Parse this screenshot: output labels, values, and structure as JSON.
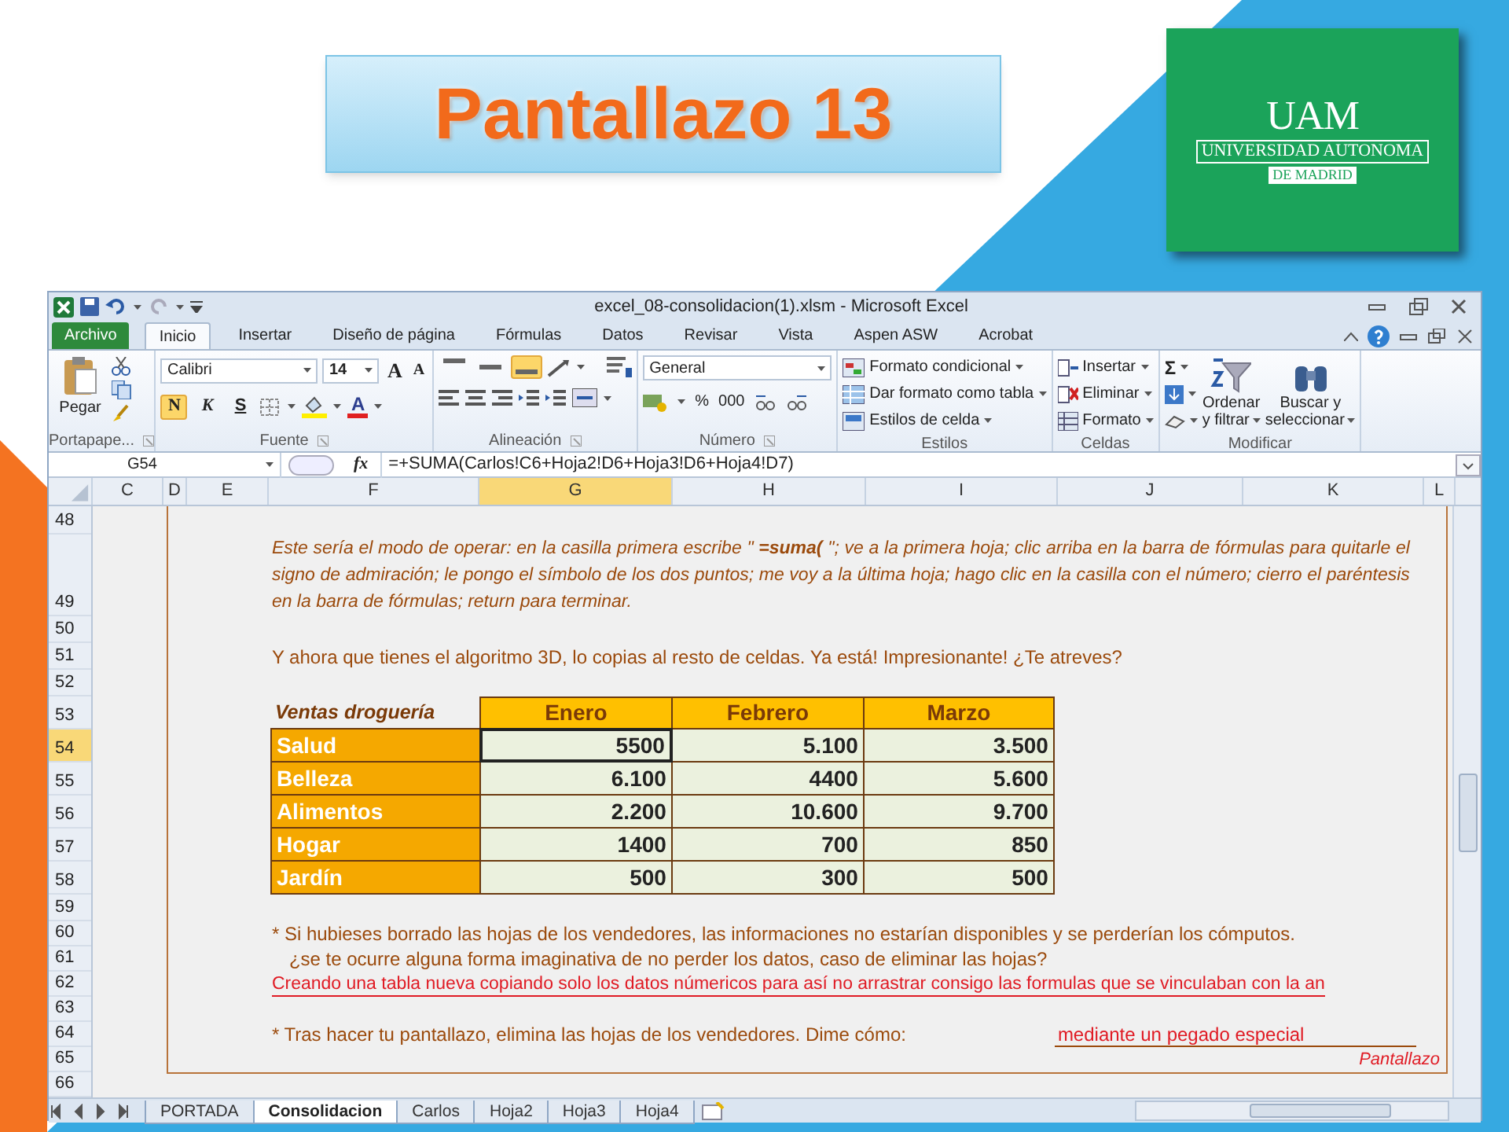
{
  "slide": {
    "title": "Pantallazo 13",
    "logo": {
      "initials": "UAM",
      "name": "UNIVERSIDAD AUTONOMA",
      "subtitle": "DE MADRID"
    }
  },
  "excel": {
    "window_title": "excel_08-consolidacion(1).xlsm - Microsoft Excel",
    "ribbon_tabs": [
      {
        "label": "Archivo",
        "kind": "file",
        "selected": false
      },
      {
        "label": "Inicio",
        "kind": "tab",
        "selected": true
      },
      {
        "label": "Insertar",
        "kind": "tab",
        "selected": false
      },
      {
        "label": "Diseño de página",
        "kind": "tab",
        "selected": false
      },
      {
        "label": "Fórmulas",
        "kind": "tab",
        "selected": false
      },
      {
        "label": "Datos",
        "kind": "tab",
        "selected": false
      },
      {
        "label": "Revisar",
        "kind": "tab",
        "selected": false
      },
      {
        "label": "Vista",
        "kind": "tab",
        "selected": false
      },
      {
        "label": "Aspen ASW",
        "kind": "tab",
        "selected": false
      },
      {
        "label": "Acrobat",
        "kind": "tab",
        "selected": false
      }
    ],
    "ribbon": {
      "clipboard": {
        "label": "Portapape...",
        "paste": "Pegar"
      },
      "font": {
        "label": "Fuente",
        "font_name": "Calibri",
        "font_size": "14",
        "grow": "A",
        "shrink": "A",
        "font_color": "A",
        "styles": [
          {
            "label": "N",
            "on": true
          },
          {
            "label": "K",
            "on": false
          },
          {
            "label": "S",
            "on": false
          }
        ]
      },
      "alignment": {
        "label": "Alineación",
        "vertical": [
          {
            "selected": false
          },
          {
            "selected": false
          },
          {
            "selected": true
          }
        ]
      },
      "number": {
        "label": "Número",
        "format": "General",
        "percent": "%",
        "thousands": "000"
      },
      "styles": {
        "label": "Estilos",
        "items": [
          "Formato condicional",
          "Dar formato como tabla",
          "Estilos de celda"
        ]
      },
      "cells": {
        "label": "Celdas",
        "items": [
          "Insertar",
          "Eliminar",
          "Formato"
        ]
      },
      "editing": {
        "label": "Modificar",
        "sum": "Σ",
        "sort": [
          "Ordenar",
          "y filtrar"
        ],
        "find": [
          "Buscar y",
          "seleccionar"
        ]
      }
    },
    "name_box": "G54",
    "function_label": "fx",
    "formula": "=+SUMA(Carlos!C6+Hoja2!D6+Hoja3!D6+Hoja4!D7)",
    "columns": [
      {
        "label": "C",
        "selected": false
      },
      {
        "label": "D",
        "selected": false
      },
      {
        "label": "E",
        "selected": false
      },
      {
        "label": "F",
        "selected": false
      },
      {
        "label": "G",
        "selected": true
      },
      {
        "label": "H",
        "selected": false
      },
      {
        "label": "I",
        "selected": false
      },
      {
        "label": "J",
        "selected": false
      },
      {
        "label": "K",
        "selected": false
      },
      {
        "label": "L",
        "selected": false
      }
    ],
    "rows": [
      {
        "number": "48",
        "selected": false
      },
      {
        "number": "49",
        "selected": false
      },
      {
        "number": "50",
        "selected": false
      },
      {
        "number": "51",
        "selected": false
      },
      {
        "number": "52",
        "selected": false
      },
      {
        "number": "53",
        "selected": false
      },
      {
        "number": "54",
        "selected": true
      },
      {
        "number": "55",
        "selected": false
      },
      {
        "number": "56",
        "selected": false
      },
      {
        "number": "57",
        "selected": false
      },
      {
        "number": "58",
        "selected": false
      },
      {
        "number": "59",
        "selected": false
      },
      {
        "number": "60",
        "selected": false
      },
      {
        "number": "61",
        "selected": false
      },
      {
        "number": "62",
        "selected": false
      },
      {
        "number": "63",
        "selected": false
      },
      {
        "number": "64",
        "selected": false
      },
      {
        "number": "65",
        "selected": false
      },
      {
        "number": "66",
        "selected": false
      }
    ],
    "sheet": {
      "instructions": "Este sería el modo de operar: en la casilla primera escribe  \" **=suma(** \";  ve a la primera hoja; clic arriba en la barra de fórmulas para quitarle el signo de admiración; le pongo el símbolo de los dos puntos; me voy a la última hoja; hago clic en la casilla con el número; cierro el paréntesis en la barra de fórmulas; return para terminar.",
      "note": "Y ahora que tienes el algoritmo 3D, lo copias al resto de celdas. Ya está! Impresionante! ¿Te atreves?",
      "table": {
        "corner": "Ventas droguería",
        "columns": [
          "Enero",
          "Febrero",
          "Marzo"
        ],
        "rows": [
          {
            "label": "Salud",
            "cells": [
              {
                "text": "5500",
                "selected": true
              },
              {
                "text": "5.100",
                "selected": false
              },
              {
                "text": "3.500",
                "selected": false
              }
            ]
          },
          {
            "label": "Belleza",
            "cells": [
              {
                "text": "6.100",
                "selected": false
              },
              {
                "text": "4400",
                "selected": false
              },
              {
                "text": "5.600",
                "selected": false
              }
            ]
          },
          {
            "label": "Alimentos",
            "cells": [
              {
                "text": "2.200",
                "selected": false
              },
              {
                "text": "10.600",
                "selected": false
              },
              {
                "text": "9.700",
                "selected": false
              }
            ]
          },
          {
            "label": "Hogar",
            "cells": [
              {
                "text": "1400",
                "selected": false
              },
              {
                "text": "700",
                "selected": false
              },
              {
                "text": "850",
                "selected": false
              }
            ]
          },
          {
            "label": "Jardín",
            "cells": [
              {
                "text": "500",
                "selected": false
              },
              {
                "text": "300",
                "selected": false
              },
              {
                "text": "500",
                "selected": false
              }
            ]
          }
        ]
      },
      "lines": [
        {
          "kind": "text",
          "text": "* Si hubieses borrado las hojas de los vendedores, las informaciones no estarían disponibles y se perderían los cómputos."
        },
        {
          "kind": "text",
          "text": "¿se te ocurre alguna forma imaginativa de no perder los datos, caso de eliminar las hojas?"
        },
        {
          "kind": "answer",
          "text": "Creando una tabla nueva copiando solo los datos númericos para así no arrastrar consigo las formulas que se vinculaban con la an"
        }
      ],
      "question": {
        "text": "* Tras hacer tu pantallazo, elimina las hojas de los vendedores. Dime cómo:",
        "answer": "mediante un pegado especial"
      },
      "signature": "Pantallazo"
    },
    "sheet_tabs": [
      {
        "label": "PORTADA",
        "selected": false
      },
      {
        "label": "Consolidacion",
        "selected": true
      },
      {
        "label": "Carlos",
        "selected": false
      },
      {
        "label": "Hoja2",
        "selected": false
      },
      {
        "label": "Hoja3",
        "selected": false
      },
      {
        "label": "Hoja4",
        "selected": false
      }
    ]
  }
}
